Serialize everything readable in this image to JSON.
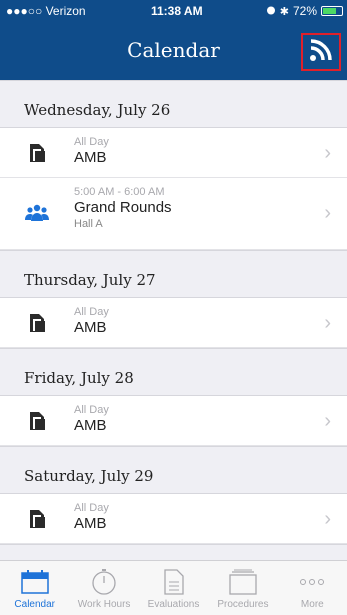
{
  "status": {
    "carrier": "●●●○○ Verizon",
    "time": "11:38 AM",
    "battery": "72%",
    "battery_level": 0.72
  },
  "header": {
    "title": "Calendar"
  },
  "days": [
    {
      "label": "Wednesday, July 26",
      "events": [
        {
          "time": "All Day",
          "title": "AMB",
          "location": "",
          "icon": "document-icon"
        },
        {
          "time": "5:00 AM - 6:00 AM",
          "title": "Grand Rounds",
          "location": "Hall A",
          "icon": "group-icon"
        }
      ]
    },
    {
      "label": "Thursday, July 27",
      "events": [
        {
          "time": "All Day",
          "title": "AMB",
          "location": "",
          "icon": "document-icon"
        }
      ]
    },
    {
      "label": "Friday, July 28",
      "events": [
        {
          "time": "All Day",
          "title": "AMB",
          "location": "",
          "icon": "document-icon"
        }
      ]
    },
    {
      "label": "Saturday, July 29",
      "events": [
        {
          "time": "All Day",
          "title": "AMB",
          "location": "",
          "icon": "document-icon"
        }
      ]
    }
  ],
  "tabs": [
    {
      "label": "Calendar",
      "icon": "calendar-icon",
      "active": true
    },
    {
      "label": "Work Hours",
      "icon": "stopwatch-icon",
      "active": false
    },
    {
      "label": "Evaluations",
      "icon": "document-lines-icon",
      "active": false
    },
    {
      "label": "Procedures",
      "icon": "folder-stack-icon",
      "active": false
    },
    {
      "label": "More",
      "icon": "more-dots-icon",
      "active": false
    }
  ],
  "colors": {
    "brand": "#0f4c8a",
    "accent": "#1e73d8",
    "highlight": "#e0202a"
  }
}
